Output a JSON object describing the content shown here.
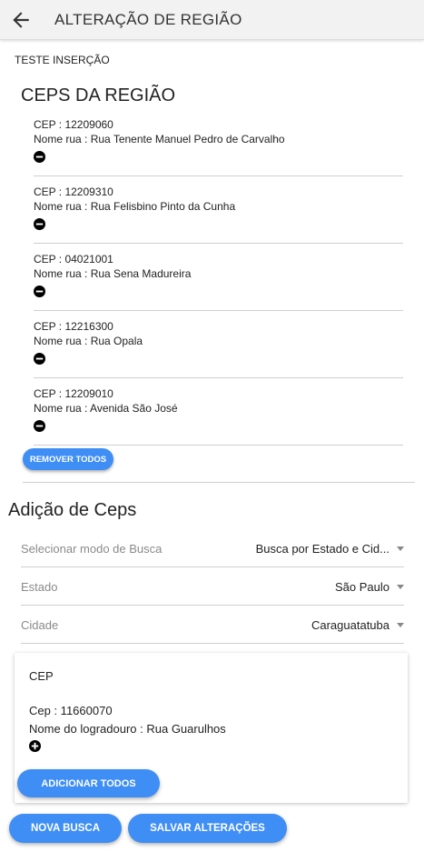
{
  "header": {
    "title": "ALTERAÇÃO DE REGIÃO",
    "back_icon": "arrow-left-icon"
  },
  "region": {
    "name": "TESTE INSERÇÃO"
  },
  "ceps_section": {
    "title": "CEPS DA REGIÃO",
    "items": [
      {
        "cep": "CEP : 12209060",
        "street": "Nome rua : Rua Tenente Manuel Pedro de Carvalho"
      },
      {
        "cep": "CEP : 12209310",
        "street": "Nome rua : Rua Felisbino Pinto da Cunha"
      },
      {
        "cep": "CEP : 04021001",
        "street": "Nome rua : Rua Sena Madureira"
      },
      {
        "cep": "CEP : 12216300",
        "street": "Nome rua : Rua Opala"
      },
      {
        "cep": "CEP : 12209010",
        "street": "Nome rua : Avenida São José"
      }
    ],
    "remove_all_label": "REMOVER TODOS"
  },
  "add_section": {
    "title": "Adição de Ceps",
    "search_mode": {
      "label": "Selecionar modo de Busca",
      "value": "Busca por Estado e Cid..."
    },
    "state": {
      "label": "Estado",
      "value": "São Paulo"
    },
    "city": {
      "label": "Cidade",
      "value": "Caraguatatuba"
    },
    "result_card": {
      "title": "CEP",
      "cep": "Cep : 11660070",
      "street": "Nome do logradouro : Rua Guarulhos",
      "add_all_label": "ADICIONAR TODOS"
    }
  },
  "actions": {
    "new_search_label": "NOVA BUSCA",
    "save_label": "SALVAR ALTERAÇÕES"
  },
  "colors": {
    "accent": "#3f8ef5",
    "appbar": "#f2f2f2"
  }
}
